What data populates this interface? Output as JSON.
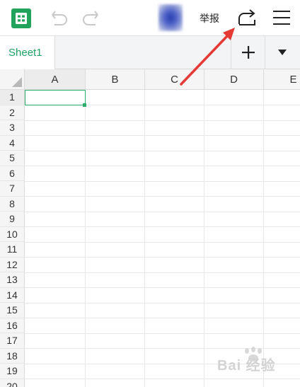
{
  "toolbar": {
    "report_label": "举报",
    "icons": [
      "sheets-app-icon",
      "undo-icon",
      "redo-icon",
      "avatar",
      "share-icon",
      "menu-icon"
    ]
  },
  "tabs": {
    "active_sheet": "Sheet1",
    "accent_color": "#1fa463"
  },
  "grid": {
    "columns": [
      "A",
      "B",
      "C",
      "D",
      "E"
    ],
    "rows": [
      "1",
      "2",
      "3",
      "4",
      "5",
      "6",
      "7",
      "8",
      "9",
      "10",
      "11",
      "12",
      "13",
      "14",
      "15",
      "16",
      "17",
      "18",
      "19",
      "20"
    ],
    "selected_cell": "A1",
    "selection_color": "#2bae6a"
  },
  "annotation": {
    "color": "#e53935"
  },
  "watermark": {
    "text": "Bai 经验"
  }
}
